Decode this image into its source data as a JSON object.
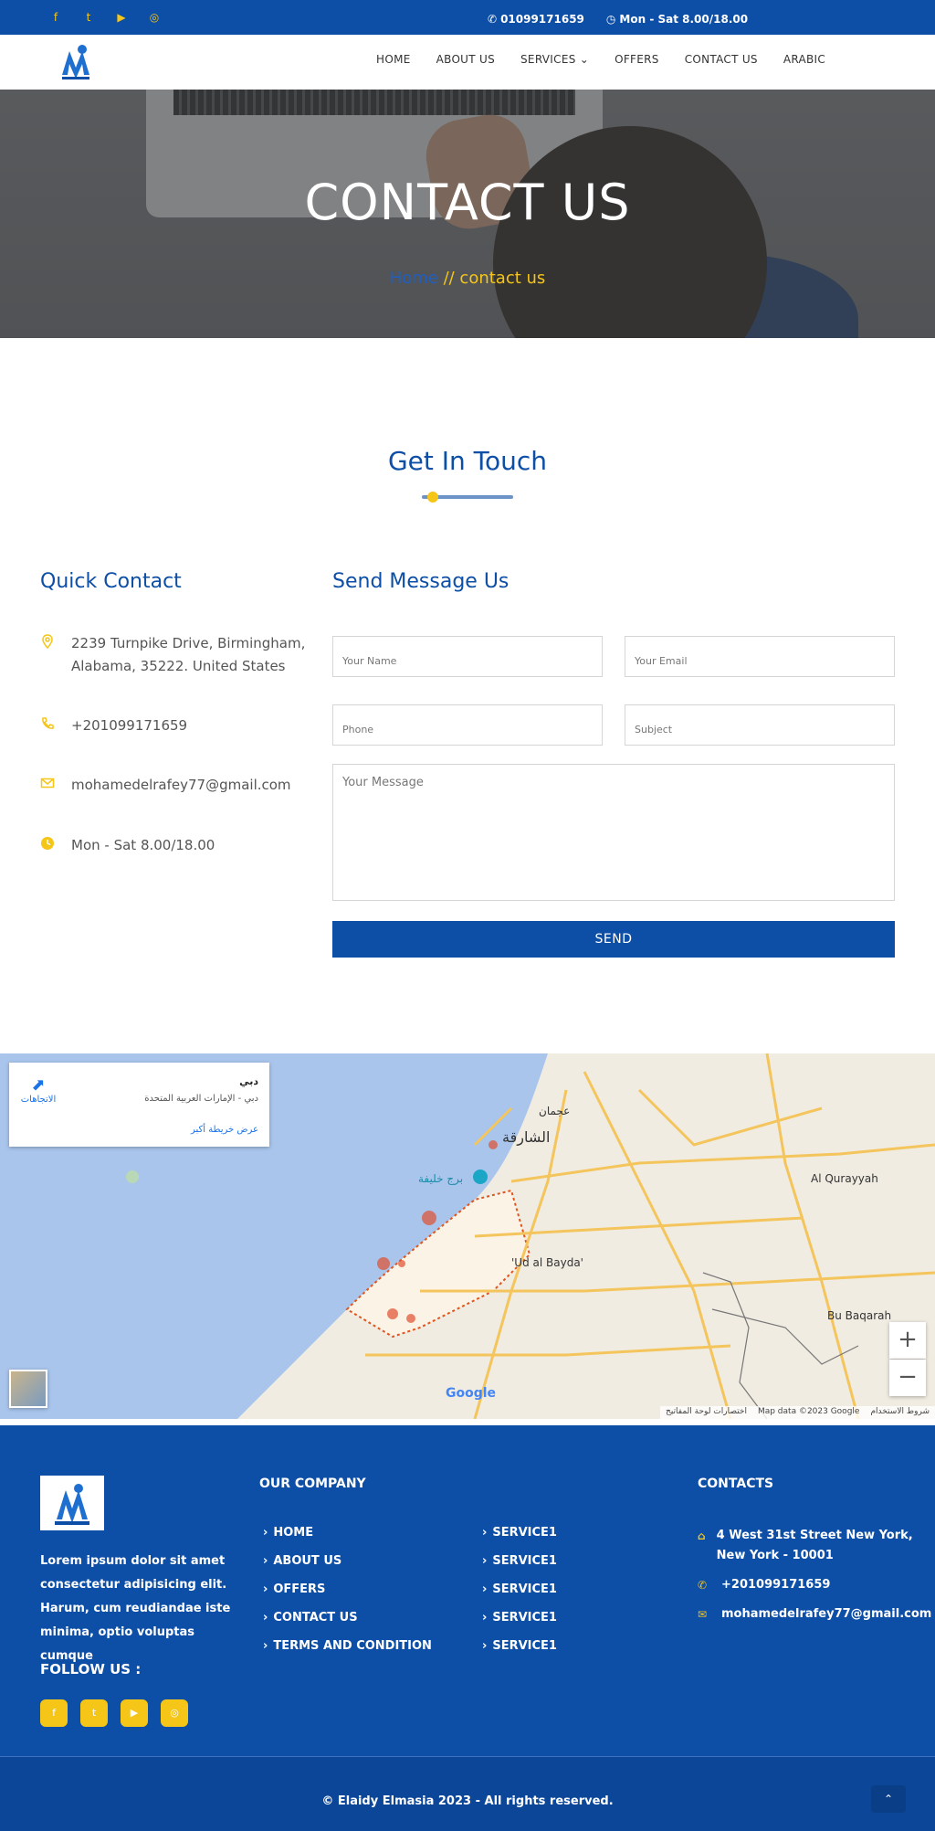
{
  "topbar": {
    "social": [
      "f",
      "t",
      "▶",
      "◎"
    ],
    "phone": "01099171659",
    "hours": "Mon - Sat 8.00/18.00"
  },
  "nav": {
    "items": [
      "HOME",
      "ABOUT US",
      "SERVICES",
      "OFFERS",
      "CONTACT US",
      "ARABIC"
    ],
    "services_caret": "⌄"
  },
  "hero": {
    "title": "CONTACT US",
    "crumb_home": "Home",
    "crumb_current": "// contact us"
  },
  "touch": {
    "title": "Get In Touch"
  },
  "quick_contact": {
    "title": "Quick Contact",
    "address_line1": "2239 Turnpike Drive, Birmingham,",
    "address_line2": "Alabama, 35222. United States",
    "phone": "+201099171659",
    "email": "mohamedelrafey77@gmail.com",
    "hours": "Mon - Sat 8.00/18.00"
  },
  "form": {
    "title": "Send Message Us",
    "name_placeholder": "Your Name",
    "email_placeholder": "Your Email",
    "phone_placeholder": "Phone",
    "subject_placeholder": "Subject",
    "message_placeholder": "Your Message",
    "send_label": "SEND"
  },
  "map": {
    "card_title": "دبي",
    "card_subtitle": "دبي - الإمارات العربية المتحدة",
    "card_link": "عرض خريطة أكبر",
    "directions_label": "الاتجاهات",
    "zoom_in": "+",
    "zoom_out": "−",
    "google": "Google",
    "attribution": [
      "Map data ©2023 Google",
      "شروط الاستخدام",
      "اختصارات لوحة المفاتيح"
    ],
    "labels": {
      "sharjah": "الشارقة",
      "ajman": "عجمان",
      "burj": "برج خليفة",
      "ud_al_bayda": "'Ud al Bayda'",
      "al_qurayyah": "Al Qurayyah",
      "bu_baqarah": "Bu Baqarah"
    }
  },
  "footer": {
    "about": "Lorem ipsum dolor sit amet consectetur adipisicing elit. Harum, cum reudiandae iste minima, optio voluptas cumque",
    "follow": "FOLLOW US :",
    "social": [
      "f",
      "t",
      "▶",
      "◎"
    ],
    "company_title": "OUR COMPANY",
    "company_links": [
      "HOME",
      "ABOUT US",
      "OFFERS",
      "CONTACT US",
      "TERMS AND CONDITION"
    ],
    "service_links": [
      "SERVICE1",
      "SERVICE1",
      "SERVICE1",
      "SERVICE1",
      "SERVICE1"
    ],
    "contacts_title": "CONTACTS",
    "address": "4 West 31st Street New York, New York - 10001",
    "phone": "+201099171659",
    "email": "mohamedelrafey77@gmail.com",
    "copyright": "© Elaidy Elmasia 2023 - All rights reserved.",
    "to_top": "⌃"
  }
}
